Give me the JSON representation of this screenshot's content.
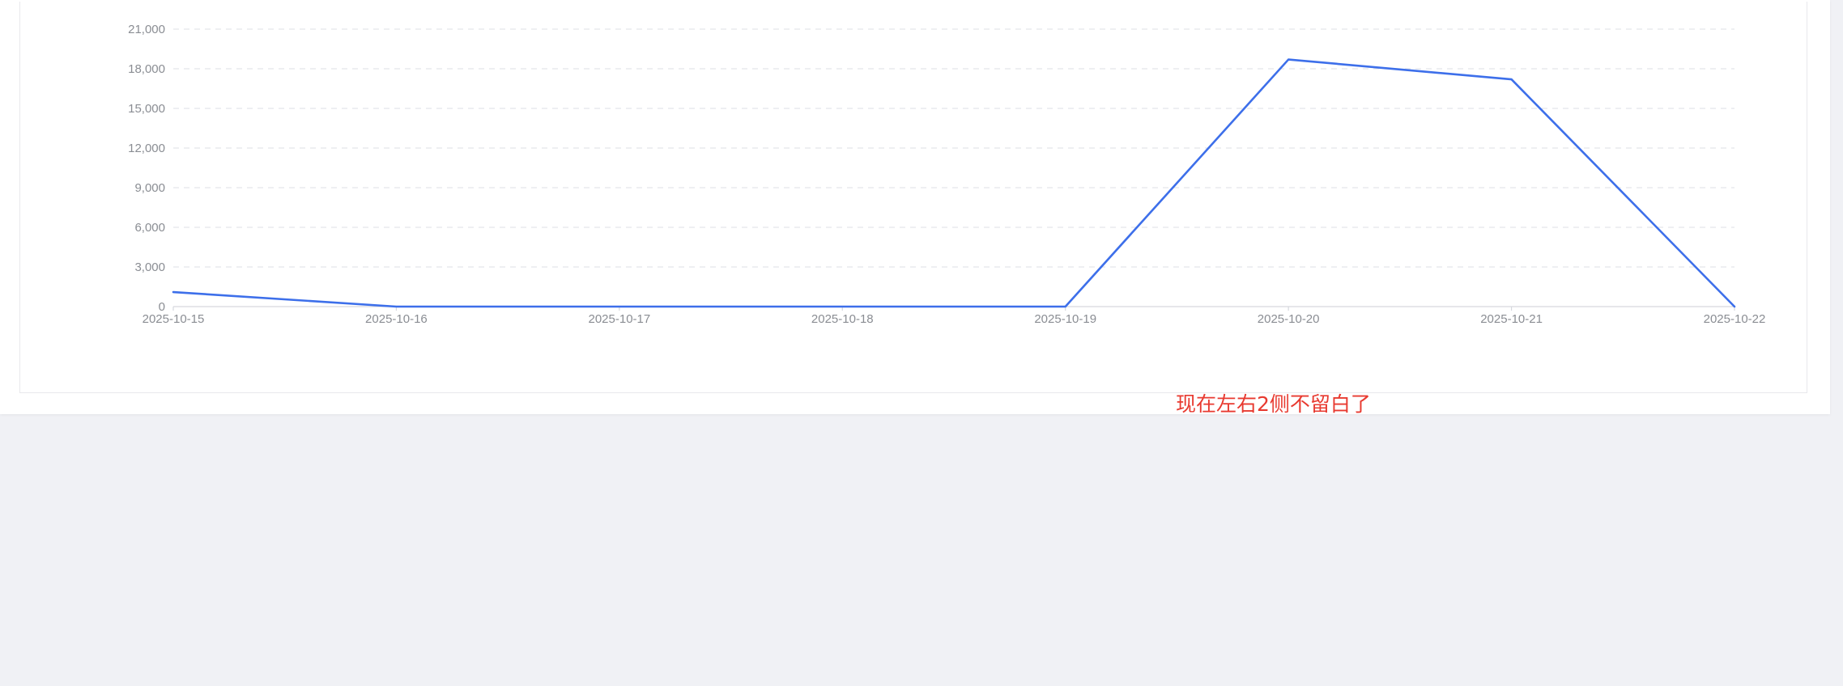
{
  "chart_data": {
    "type": "line",
    "categories": [
      "2025-10-15",
      "2025-10-16",
      "2025-10-17",
      "2025-10-18",
      "2025-10-19",
      "2025-10-20",
      "2025-10-21",
      "2025-10-22"
    ],
    "series": [
      {
        "values": [
          1100,
          0,
          0,
          0,
          0,
          18700,
          17200,
          0
        ],
        "color": "#3d6fea"
      }
    ],
    "yticks": [
      "0",
      "3,000",
      "6,000",
      "9,000",
      "12,000",
      "15,000",
      "18,000",
      "21,000"
    ],
    "ylim": [
      0,
      21000
    ],
    "grid": true,
    "grid_style": "dashed",
    "title": "",
    "xlabel": "",
    "ylabel": ""
  },
  "annotation": {
    "text": "现在左右2侧不留白了",
    "color": "#e83a30"
  }
}
